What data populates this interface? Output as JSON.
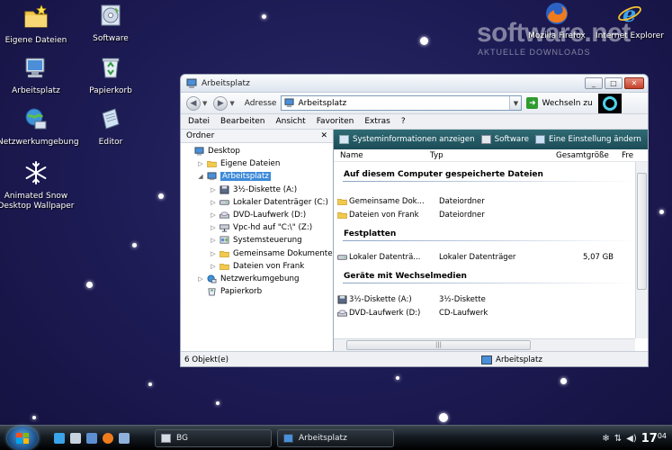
{
  "desktop": {
    "icons": [
      {
        "label": "Eigene Dateien",
        "icon": "folder-star-icon"
      },
      {
        "label": "Software",
        "icon": "software-cd-icon"
      },
      {
        "label": "Arbeitsplatz",
        "icon": "computer-icon"
      },
      {
        "label": "Papierkorb",
        "icon": "recycle-bin-icon"
      },
      {
        "label": "Netzwerkumgebung",
        "icon": "network-globe-icon"
      },
      {
        "label": "Editor",
        "icon": "notepad-icon"
      },
      {
        "label": "Animated Snow\nDesktop Wallpaper",
        "icon": "snowflake-icon"
      },
      {
        "label": "Mozilla Firefox",
        "icon": "firefox-icon"
      },
      {
        "label": "Internet Explorer",
        "icon": "internet-explorer-icon"
      }
    ],
    "watermark": {
      "main": "software.net",
      "sub": "AKTUELLE DOWNLOADS"
    }
  },
  "window": {
    "title": "Arbeitsplatz",
    "controls": {
      "minimize": "_",
      "maximize": "□",
      "close": "✕"
    },
    "address": {
      "label": "Adresse",
      "value": "Arbeitsplatz",
      "go_label": "Wechseln zu"
    },
    "menu": [
      "Datei",
      "Bearbeiten",
      "Ansicht",
      "Favoriten",
      "Extras",
      "?"
    ],
    "folders": {
      "header": "Ordner",
      "close": "✕",
      "tree": [
        {
          "label": "Desktop",
          "depth": 0,
          "twisty": "",
          "icon": "desktop-icon"
        },
        {
          "label": "Eigene Dateien",
          "depth": 1,
          "twisty": "▷",
          "icon": "folder-icon"
        },
        {
          "label": "Arbeitsplatz",
          "depth": 1,
          "twisty": "◢",
          "icon": "computer-icon",
          "selected": true
        },
        {
          "label": "3½-Diskette (A:)",
          "depth": 2,
          "twisty": "▷",
          "icon": "floppy-icon"
        },
        {
          "label": "Lokaler Datenträger (C:)",
          "depth": 2,
          "twisty": "▷",
          "icon": "hard-drive-icon"
        },
        {
          "label": "DVD-Laufwerk (D:)",
          "depth": 2,
          "twisty": "▷",
          "icon": "dvd-drive-icon"
        },
        {
          "label": "Vpc-hd auf \"C:\\\" (Z:)",
          "depth": 2,
          "twisty": "▷",
          "icon": "network-drive-icon"
        },
        {
          "label": "Systemsteuerung",
          "depth": 2,
          "twisty": "▷",
          "icon": "control-panel-icon"
        },
        {
          "label": "Gemeinsame Dokumente",
          "depth": 2,
          "twisty": "▷",
          "icon": "folder-icon"
        },
        {
          "label": "Dateien von Frank",
          "depth": 2,
          "twisty": "▷",
          "icon": "folder-icon"
        },
        {
          "label": "Netzwerkumgebung",
          "depth": 1,
          "twisty": "▷",
          "icon": "network-icon"
        },
        {
          "label": "Papierkorb",
          "depth": 1,
          "twisty": "",
          "icon": "recycle-bin-icon"
        }
      ]
    },
    "tasks": [
      {
        "label": "Systeminformationen anzeigen",
        "icon": "sysinfo-icon"
      },
      {
        "label": "Software",
        "icon": "software-icon"
      },
      {
        "label": "Eine Einstellung ändern",
        "icon": "settings-icon"
      }
    ],
    "columns": [
      "Name",
      "Typ",
      "Gesamtgröße",
      "Fre"
    ],
    "sections": [
      {
        "title": "Auf diesem Computer gespeicherte Dateien",
        "items": [
          {
            "name": "Gemeinsame Dok...",
            "type": "Dateiordner",
            "size": "",
            "icon": "folder-icon"
          },
          {
            "name": "Dateien von Frank",
            "type": "Dateiordner",
            "size": "",
            "icon": "folder-icon"
          }
        ]
      },
      {
        "title": "Festplatten",
        "items": [
          {
            "name": "Lokaler Datenträ...",
            "type": "Lokaler Datenträger",
            "size": "5,07 GB",
            "icon": "hard-drive-icon"
          }
        ]
      },
      {
        "title": "Geräte mit Wechselmedien",
        "items": [
          {
            "name": "3½-Diskette (A:)",
            "type": "3½-Diskette",
            "size": "",
            "icon": "floppy-icon"
          },
          {
            "name": "DVD-Laufwerk (D:)",
            "type": "CD-Laufwerk",
            "size": "",
            "icon": "dvd-drive-icon"
          }
        ]
      }
    ],
    "hscroll_grip": "|||",
    "status": {
      "left": "6 Objekt(e)",
      "right": "Arbeitsplatz"
    }
  },
  "taskbar": {
    "buttons": [
      {
        "label": "BG",
        "icon": "app-icon"
      },
      {
        "label": "Arbeitsplatz",
        "icon": "computer-icon"
      }
    ],
    "clock": {
      "hour": "17",
      "minute": "04"
    }
  },
  "colors": {
    "accent": "#3d8ad8",
    "task_panel": "#2a5f6a",
    "desktop": "#1c1a52"
  }
}
